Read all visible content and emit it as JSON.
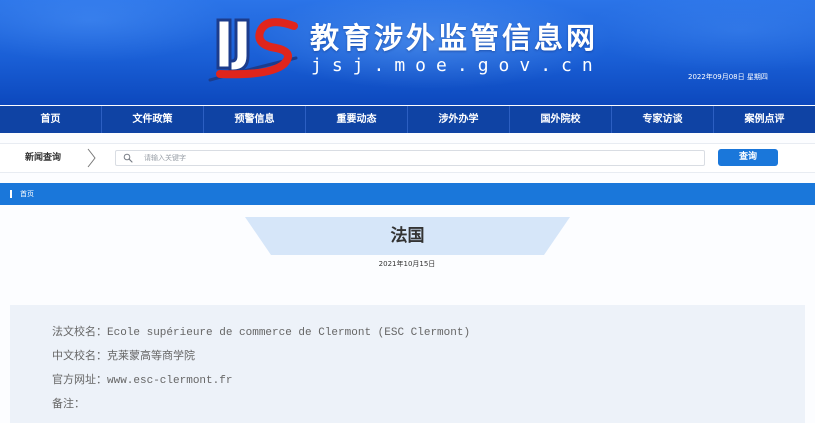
{
  "site": {
    "title": "教育涉外监管信息网",
    "url_text": "jsj.moe.gov.cn",
    "date": "2022年09月08日 星期四"
  },
  "nav": {
    "items": [
      {
        "label": "首页"
      },
      {
        "label": "文件政策"
      },
      {
        "label": "预警信息"
      },
      {
        "label": "重要动态"
      },
      {
        "label": "涉外办学"
      },
      {
        "label": "国外院校"
      },
      {
        "label": "专家访谈"
      },
      {
        "label": "案例点评"
      }
    ]
  },
  "search": {
    "label": "新闻查询",
    "placeholder": "请输入关键字",
    "button": "查询"
  },
  "breadcrumb": {
    "items": [
      "首页"
    ]
  },
  "article": {
    "title": "法国",
    "date": "2021年10月15日",
    "fields": [
      {
        "label": "法文校名：",
        "value": "Ecole supérieure de commerce de Clermont (ESC Clermont)"
      },
      {
        "label": "中文校名：",
        "value": "克莱蒙高等商学院"
      },
      {
        "label": "官方网址：",
        "value": "www.esc-clermont.fr"
      },
      {
        "label": "备注："
      }
    ]
  },
  "icons": {
    "logo": "site-logo-icon",
    "search_divider": "chevron-right-icon",
    "search": "search-icon",
    "breadcrumb": "breadcrumb-marker-icon"
  },
  "colors": {
    "header_top": "#2b74e8",
    "header_bottom": "#0c48bd",
    "nav_bg": "#0f43a4",
    "accent": "#1a77da",
    "title_bg": "#d6e6f9",
    "content_bg": "#edf2f9",
    "logo_red": "#e0251c"
  }
}
